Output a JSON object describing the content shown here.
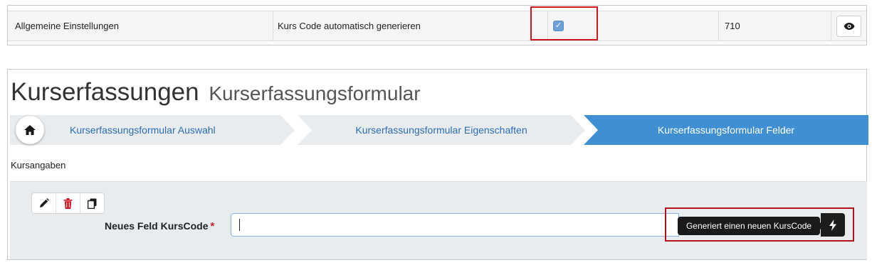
{
  "table": {
    "row": {
      "category": "Allgemeine Einstellungen",
      "setting": "Kurs Code automatisch generieren",
      "enabled": true,
      "value": "710"
    },
    "view_icon": "eye-icon"
  },
  "page": {
    "title": "Kurserfassungen",
    "subtitle": "Kurserfassungsformular"
  },
  "wizard": {
    "home_icon": "home-icon",
    "steps": [
      {
        "label": "Kurserfassungsformular Auswahl",
        "active": false
      },
      {
        "label": "Kurserfassungsformular Eigenschaften",
        "active": false
      },
      {
        "label": "Kurserfassungsformular Felder",
        "active": true
      }
    ]
  },
  "section": {
    "label": "Kursangaben"
  },
  "field": {
    "toolbar": [
      "pencil-icon",
      "trash-icon",
      "copy-icon"
    ],
    "label": "Neues Feld KursCode",
    "required_mark": "*",
    "value": "",
    "tooltip": "Generiert einen neuen KursCode",
    "generate_icon": "bolt-icon"
  },
  "colors": {
    "accent": "#3f8fd2",
    "highlight": "#d1121f",
    "delete": "#d1121f",
    "panel_bg": "#e9ecef"
  }
}
